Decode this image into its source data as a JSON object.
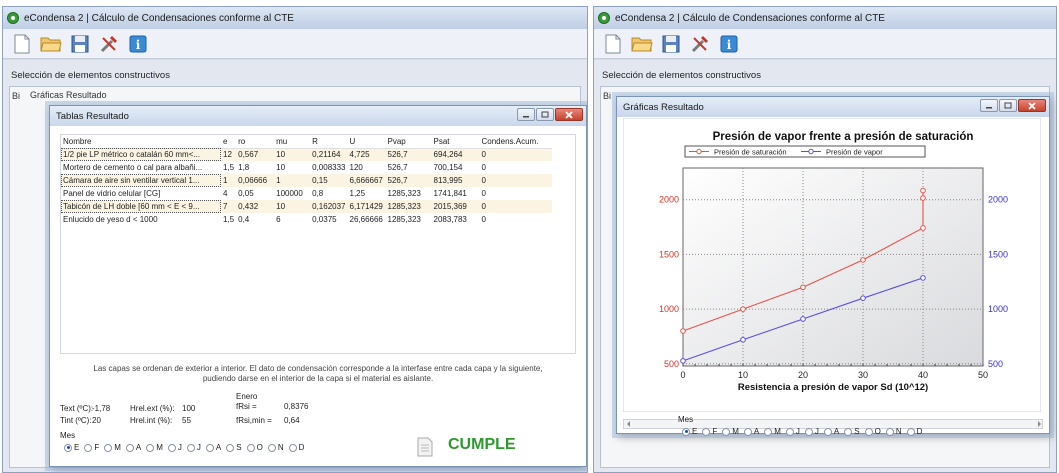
{
  "app_title": "eCondensa 2 | Cálculo de Condensaciones conforme al CTE",
  "toolbar": [
    "new-icon",
    "open-folder-icon",
    "save-icon",
    "tools-icon",
    "info-icon"
  ],
  "section_label": "Selección de elementos constructivos",
  "background_tab": "Gráficas Resultado",
  "tables_window": {
    "title": "Tablas Resultado",
    "columns": [
      "Nombre",
      "e",
      "ro",
      "mu",
      "R",
      "U",
      "Pvap",
      "Psat",
      "Condens.Acum."
    ],
    "rows": [
      [
        "1/2 pie LP métrico o catalán 60 mm<...",
        "12",
        "0,567",
        "10",
        "0,21164",
        "4,725",
        "526,7",
        "694,264",
        "0"
      ],
      [
        "Mortero de cemento o cal para albañi...",
        "1,5",
        "1,8",
        "10",
        "0,008333",
        "120",
        "526,7",
        "700,154",
        "0"
      ],
      [
        "Cámara de aire sin ventilar vertical 1...",
        "1",
        "0,06666",
        "1",
        "0,15",
        "6,666667",
        "526,7",
        "813,995",
        "0"
      ],
      [
        "Panel de vidrio celular [CG]",
        "4",
        "0,05",
        "100000",
        "0,8",
        "1,25",
        "1285,323",
        "1741,841",
        "0"
      ],
      [
        "Tabicón de LH doble [60 mm < E < 9...",
        "7",
        "0,432",
        "10",
        "0,162037",
        "6,171429",
        "1285,323",
        "2015,369",
        "0"
      ],
      [
        "Enlucido de yeso d < 1000",
        "1,5",
        "0,4",
        "6",
        "0,0375",
        "26,66666",
        "1285,323",
        "2083,783",
        "0"
      ]
    ],
    "note_line1": "Las capas se ordenan de exterior a interior. El dato de condensación corresponde a la interfase entre cada capa y la siguiente,",
    "note_line2": "pudiendo darse en el interior de la capa si el material es aislante.",
    "params": {
      "text_label": "Text (ºC):",
      "text_value": "-1,78",
      "tint_label": "Tint (ºC):",
      "tint_value": "20",
      "hrelext_label": "Hrel.ext (%):",
      "hrelext_value": "100",
      "hrelint_label": "Hrel.int (%):",
      "hrelint_value": "55",
      "month_label": "Enero",
      "frsi_label": "fRsi =",
      "frsi_value": "0,8376",
      "frsimin_label": "fRsi,min =",
      "frsimin_value": "0,64"
    },
    "mes_label": "Mes",
    "months": [
      "E",
      "F",
      "M",
      "A",
      "M",
      "J",
      "J",
      "A",
      "S",
      "O",
      "N",
      "D"
    ],
    "selected_month": "E",
    "result": "CUMPLE"
  },
  "graph_window": {
    "title": "Gráficas Resultado",
    "mes_label": "Mes",
    "months": [
      "E",
      "F",
      "M",
      "A",
      "M",
      "J",
      "J",
      "A",
      "S",
      "O",
      "N",
      "D"
    ],
    "selected_month": "E"
  },
  "chart_data": {
    "type": "line",
    "title": "Presión de vapor frente a presión de saturación",
    "xlabel": "Resistencia a presión de vapor Sd (10^12)",
    "ylabel": "",
    "xlim": [
      0,
      50
    ],
    "ylim": [
      480,
      2290
    ],
    "xticks": [
      0,
      10,
      20,
      30,
      40,
      50
    ],
    "yticks": [
      500,
      1000,
      1500,
      2000
    ],
    "grid": true,
    "legend_position": "top",
    "series": [
      {
        "name": "Presión de saturación",
        "color": "#e8504a",
        "x": [
          0,
          10,
          20,
          30,
          40,
          40,
          40
        ],
        "y": [
          800,
          1000,
          1200,
          1450,
          1741.841,
          2015.369,
          2083.783
        ]
      },
      {
        "name": "Presión de vapor",
        "color": "#5a4ee0",
        "x": [
          0,
          10,
          20,
          30,
          40
        ],
        "y": [
          526.7,
          720,
          910,
          1100,
          1285.323
        ]
      }
    ]
  }
}
